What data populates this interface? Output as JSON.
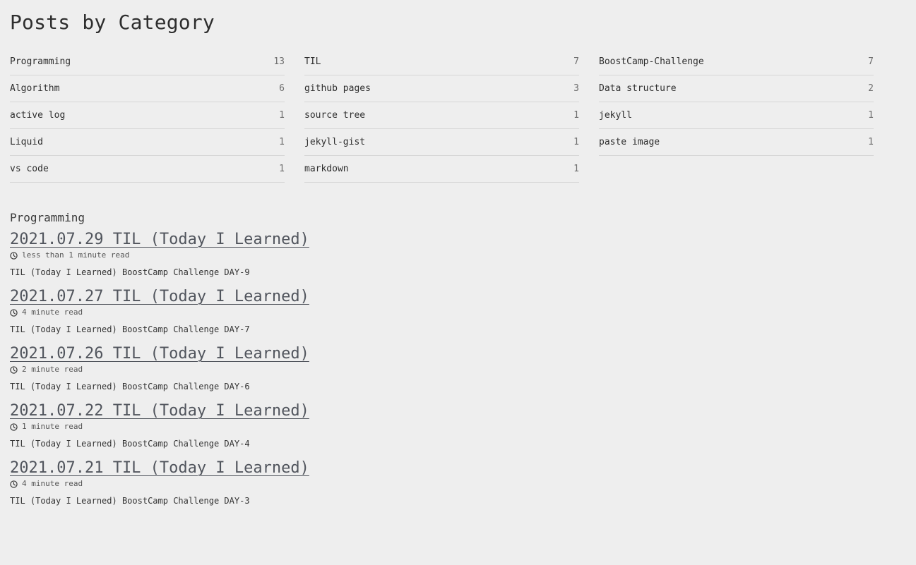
{
  "page": {
    "title": "Posts by Category"
  },
  "categories": [
    {
      "name": "Programming",
      "count": "13"
    },
    {
      "name": "Algorithm",
      "count": "6"
    },
    {
      "name": "active log",
      "count": "1"
    },
    {
      "name": "Liquid",
      "count": "1"
    },
    {
      "name": "vs code",
      "count": "1"
    },
    {
      "name": "TIL",
      "count": "7"
    },
    {
      "name": "github pages",
      "count": "3"
    },
    {
      "name": "source tree",
      "count": "1"
    },
    {
      "name": "jekyll-gist",
      "count": "1"
    },
    {
      "name": "markdown",
      "count": "1"
    },
    {
      "name": "BoostCamp-Challenge",
      "count": "7"
    },
    {
      "name": "Data structure",
      "count": "2"
    },
    {
      "name": "jekyll",
      "count": "1"
    },
    {
      "name": "paste image",
      "count": "1"
    }
  ],
  "section": {
    "title": "Programming"
  },
  "posts": [
    {
      "title": "2021.07.29 TIL (Today I Learned)",
      "read_time": "less than 1 minute read",
      "excerpt": "TIL (Today I Learned) BoostCamp Challenge DAY-9"
    },
    {
      "title": "2021.07.27 TIL (Today I Learned)",
      "read_time": "4 minute read",
      "excerpt": "TIL (Today I Learned) BoostCamp Challenge DAY-7"
    },
    {
      "title": "2021.07.26 TIL (Today I Learned)",
      "read_time": "2 minute read",
      "excerpt": "TIL (Today I Learned) BoostCamp Challenge DAY-6"
    },
    {
      "title": "2021.07.22 TIL (Today I Learned)",
      "read_time": "1 minute read",
      "excerpt": "TIL (Today I Learned) BoostCamp Challenge DAY-4"
    },
    {
      "title": "2021.07.21 TIL (Today I Learned)",
      "read_time": "4 minute read",
      "excerpt": "TIL (Today I Learned) BoostCamp Challenge DAY-3"
    }
  ],
  "icons": {
    "read_time": "clock-icon"
  },
  "colors": {
    "background": "#eeeeee",
    "link": "#51555d",
    "divider": "#d6d6d6"
  }
}
